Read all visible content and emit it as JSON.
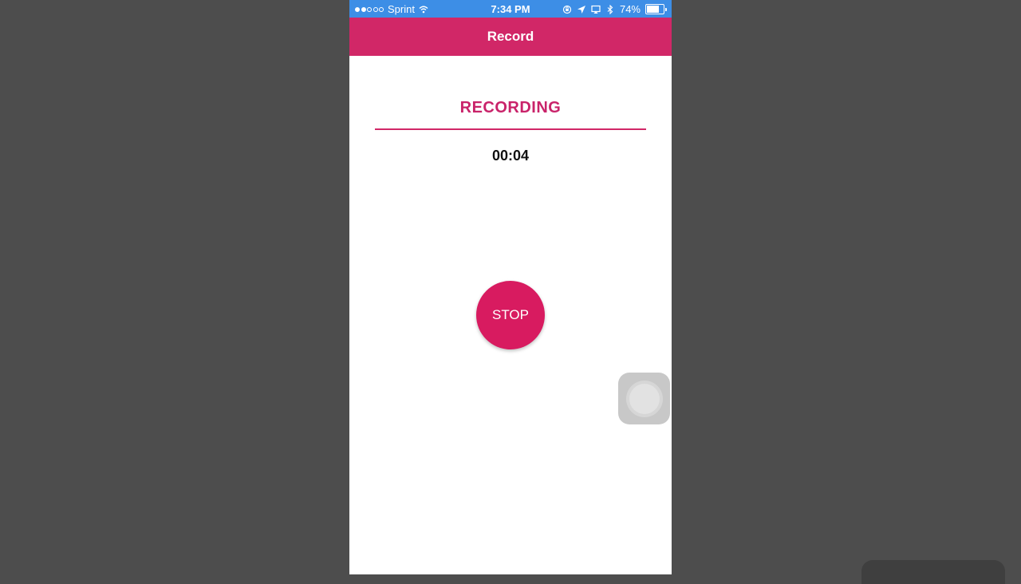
{
  "status_bar": {
    "carrier": "Sprint",
    "time": "7:34 PM",
    "battery_percent_text": "74%",
    "battery_level": 0.74,
    "signal_bars_filled": 2,
    "signal_bars_total": 5,
    "icons": [
      "wifi-icon",
      "rotation-lock-icon",
      "location-arrow-icon",
      "airplay-icon",
      "bluetooth-icon",
      "battery-icon"
    ]
  },
  "nav": {
    "title": "Record"
  },
  "main": {
    "status_heading": "RECORDING",
    "timer": "00:04",
    "stop_label": "STOP"
  },
  "colors": {
    "accent": "#d12767",
    "status_bar": "#3d8ee6",
    "background": "#4d4d4d"
  }
}
